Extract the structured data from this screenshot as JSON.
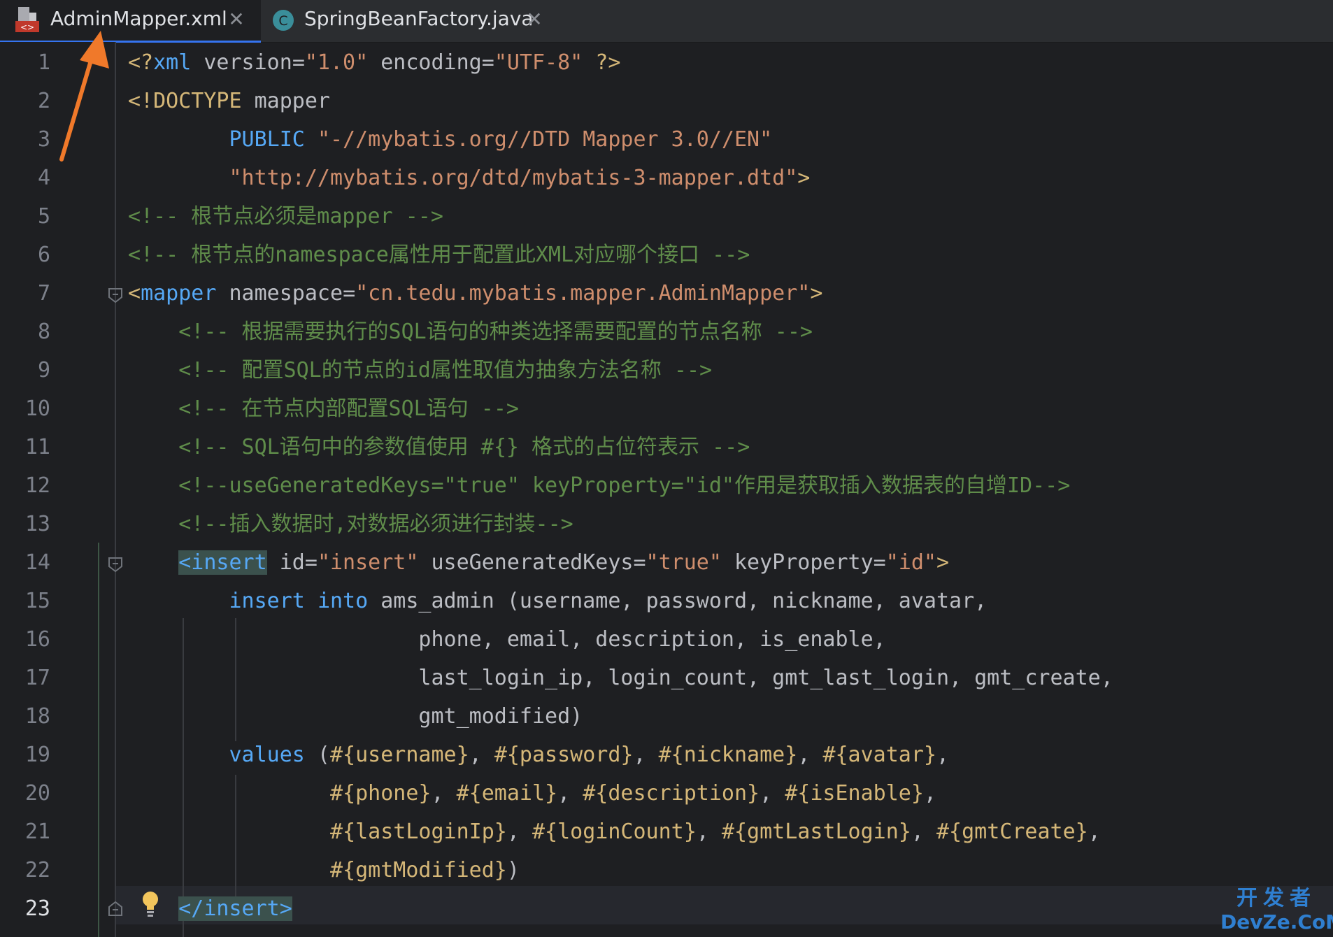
{
  "tabs": [
    {
      "label": "AdminMapper.xml",
      "icon": "xml-file-icon",
      "active": true
    },
    {
      "label": "SpringBeanFactory.java",
      "icon": "java-class-icon",
      "active": false
    }
  ],
  "line_numbers": [
    "1",
    "2",
    "3",
    "4",
    "5",
    "6",
    "7",
    "8",
    "9",
    "10",
    "11",
    "12",
    "13",
    "14",
    "15",
    "16",
    "17",
    "18",
    "19",
    "20",
    "21",
    "22",
    "23"
  ],
  "code": {
    "l1": {
      "p1": "<?",
      "p2": "xml ",
      "p3": "version",
      "p4": "=",
      "p5": "\"1.0\"",
      "p6": " encoding",
      "p7": "=",
      "p8": "\"UTF-8\"",
      "p9": " ?>"
    },
    "l2": {
      "p1": "<!",
      "p2": "DOCTYPE",
      "p3": " mapper"
    },
    "l3": {
      "p1": "        PUBLIC ",
      "p2": "\"-//mybatis.org//DTD Mapper 3.0//EN\""
    },
    "l4": {
      "p1": "        ",
      "p2": "\"http://mybatis.org/dtd/mybatis-3-mapper.dtd\"",
      "p3": ">"
    },
    "l5": {
      "p1": "<!-- 根节点必须是mapper -->"
    },
    "l6": {
      "p1": "<!-- 根节点的namespace属性用于配置此XML对应哪个接口 -->"
    },
    "l7": {
      "p1": "<",
      "p2": "mapper",
      "p3": " namespace",
      "p4": "=",
      "p5": "\"cn.tedu.mybatis.mapper.AdminMapper\"",
      "p6": ">"
    },
    "l8": {
      "p1": "    <!-- 根据需要执行的SQL语句的种类选择需要配置的节点名称 -->"
    },
    "l9": {
      "p1": "    <!-- 配置SQL的节点的id属性取值为抽象方法名称 -->"
    },
    "l10": {
      "p1": "    <!-- 在节点内部配置SQL语句 -->"
    },
    "l11": {
      "p1": "    <!-- SQL语句中的参数值使用 #{} 格式的占位符表示 -->"
    },
    "l12": {
      "p1": "    <!--useGeneratedKeys=\"true\" keyProperty=\"id\"作用是获取插入数据表的自增ID-->"
    },
    "l13": {
      "p1": "    <!--插入数据时,对数据必须进行封装-->"
    },
    "l14": {
      "p0": "    ",
      "p1": "<insert",
      "p2": " id",
      "p3": "=",
      "p4": "\"insert\"",
      "p5": " useGeneratedKeys",
      "p6": "=",
      "p7": "\"true\"",
      "p8": " keyProperty",
      "p9": "=",
      "p10": "\"id\"",
      "p11": ">"
    },
    "l15": {
      "p1": "        ",
      "p2": "insert",
      "p3": " ",
      "p4": "into",
      "p5": " ams_admin (username, password, nickname, avatar,"
    },
    "l16": {
      "p1": "                       phone, email, description, is_enable,"
    },
    "l17": {
      "p1": "                       last_login_ip, login_count, gmt_last_login, gmt_create,"
    },
    "l18": {
      "p1": "                       gmt_modified)"
    },
    "l19": {
      "p1": "        ",
      "p2": "values",
      "p3": " (",
      "p4": "#{username}",
      "p5": ", ",
      "p6": "#{password}",
      "p7": ", ",
      "p8": "#{nickname}",
      "p9": ", ",
      "p10": "#{avatar}",
      "p11": ","
    },
    "l20": {
      "p1": "                ",
      "p2": "#{phone}",
      "p3": ", ",
      "p4": "#{email}",
      "p5": ", ",
      "p6": "#{description}",
      "p7": ", ",
      "p8": "#{isEnable}",
      "p9": ","
    },
    "l21": {
      "p1": "                ",
      "p2": "#{lastLoginIp}",
      "p3": ", ",
      "p4": "#{loginCount}",
      "p5": ", ",
      "p6": "#{gmtLastLogin}",
      "p7": ", ",
      "p8": "#{gmtCreate}",
      "p9": ","
    },
    "l22": {
      "p1": "                ",
      "p2": "#{gmtModified}",
      "p3": ")"
    },
    "l23": {
      "p0": "    ",
      "p1": "</insert>"
    }
  },
  "watermark": {
    "top": "开发者",
    "bottom": "DevZe.CoM"
  },
  "colors": {
    "background": "#1e1f22",
    "tag": "#56a8f5",
    "string": "#6aab73",
    "comment": "#5f8c4a",
    "punctuation": "#d5b778",
    "highlight": "#3b514d",
    "arrow": "#f0792a"
  }
}
